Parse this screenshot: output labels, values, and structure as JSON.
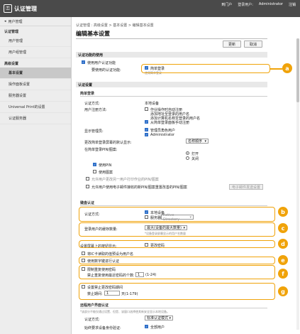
{
  "header": {
    "app_title": "认证管理",
    "links": [
      "到门户",
      "登录用户:",
      "Administrator",
      "注销"
    ]
  },
  "sidebar": {
    "back_label": "用户管理",
    "section1": "认证管理",
    "items1": [
      "用户管理",
      "用户组管理"
    ],
    "section2": "高级设置",
    "items2": [
      "基本设置",
      "操作面板设置",
      "服务器设置"
    ],
    "items3": [
      "Universal Print的设置",
      "认证服务器"
    ]
  },
  "main": {
    "breadcrumb": "认证管理 : 高级设置 > 基本设置 > 编辑基本设置",
    "page_title": "编辑基本设置",
    "update_label": "更新",
    "cancel_label": "取消",
    "func_head": "认证功能的使用",
    "use_user_auth": "使用用户认证功能",
    "auth_label": "要使用的认证功能:",
    "auth_value": "简单登录",
    "auth_sub": "使用简单登录",
    "basic_head": "认证设置",
    "simple_login": "简单登录",
    "auth_method_label": "认证方式:",
    "auth_method_value": "本地设备",
    "user_reg_label": "用户注册方法:",
    "user_reg_opts": [
      "作业操作时自动注册",
      "添加地址至登录的用户名",
      "添加计算机名称至登录的用户名",
      "从简单登录面板手动注册"
    ],
    "display_mgmt_label": "显示管理员:",
    "display_mgmt_opts": [
      "管理员角色用户",
      "Administrator"
    ],
    "sort_label": "更改简单登录屏幕的默认显示:",
    "sort_value": "名称顺序",
    "pin_label": "在简单登录PIN/图案:",
    "pin_radio": [
      "打开",
      "关闭"
    ],
    "use_pin": "使用PIN",
    "use_pattern": "使用图案",
    "opt_text1": "允许用户更改另一用户打印作业的PIN/图案",
    "opt_text2": "允许用户使用电子邮件接收的新PIN/图案重置改善的PIN/图案",
    "opt_btn": "电子邮件发送设置",
    "kbd_head": "键盘认证",
    "kb_method_label": "认证方式:",
    "kb_method_opts": [
      "本地设备",
      "服务器"
    ],
    "kb_server_value": "Active Directory",
    "kb_count_label": "登录用户的缓存数量:",
    "kb_count_value": "最大(设备的最大数量)",
    "kb_count_note": "*设备登录屏幕显示的用户名数量",
    "kb_screen_label": "设置屏幕上的按钮显示:",
    "kb_screen_value": "更改密码",
    "ic_card": "将IC卡读取的值预设为用户名",
    "use_digit": "使用数字键进行认证",
    "restrict_login": "限制重复使用密码",
    "max_label": "禁止重复使用最近密码的个数:",
    "max_value": "1",
    "max_range": "(1-24)",
    "pwd_period_label": "设置禁止更改密码期间",
    "pwd_days_label": "禁止期间:",
    "pwd_days_value": "1",
    "pwd_days_unit": "天(1-179)",
    "remote_head": "远程用户界面认证",
    "remote_note": "*该部分不能仅通过设置、但是、该窗口选择使其新安全显示本地设备。",
    "remote_method_label": "认证方式:",
    "remote_method_value": "标准认证模式",
    "remote_rule_label": "始终要求设备身份验证:",
    "remote_rule_value": "全部用户"
  },
  "callouts": [
    "a",
    "b",
    "c",
    "d",
    "e",
    "f",
    "g"
  ],
  "colors": {
    "accent": "#f0a30a",
    "checkbox": "#2b6dc8",
    "topbar": "#4a4a4a"
  }
}
